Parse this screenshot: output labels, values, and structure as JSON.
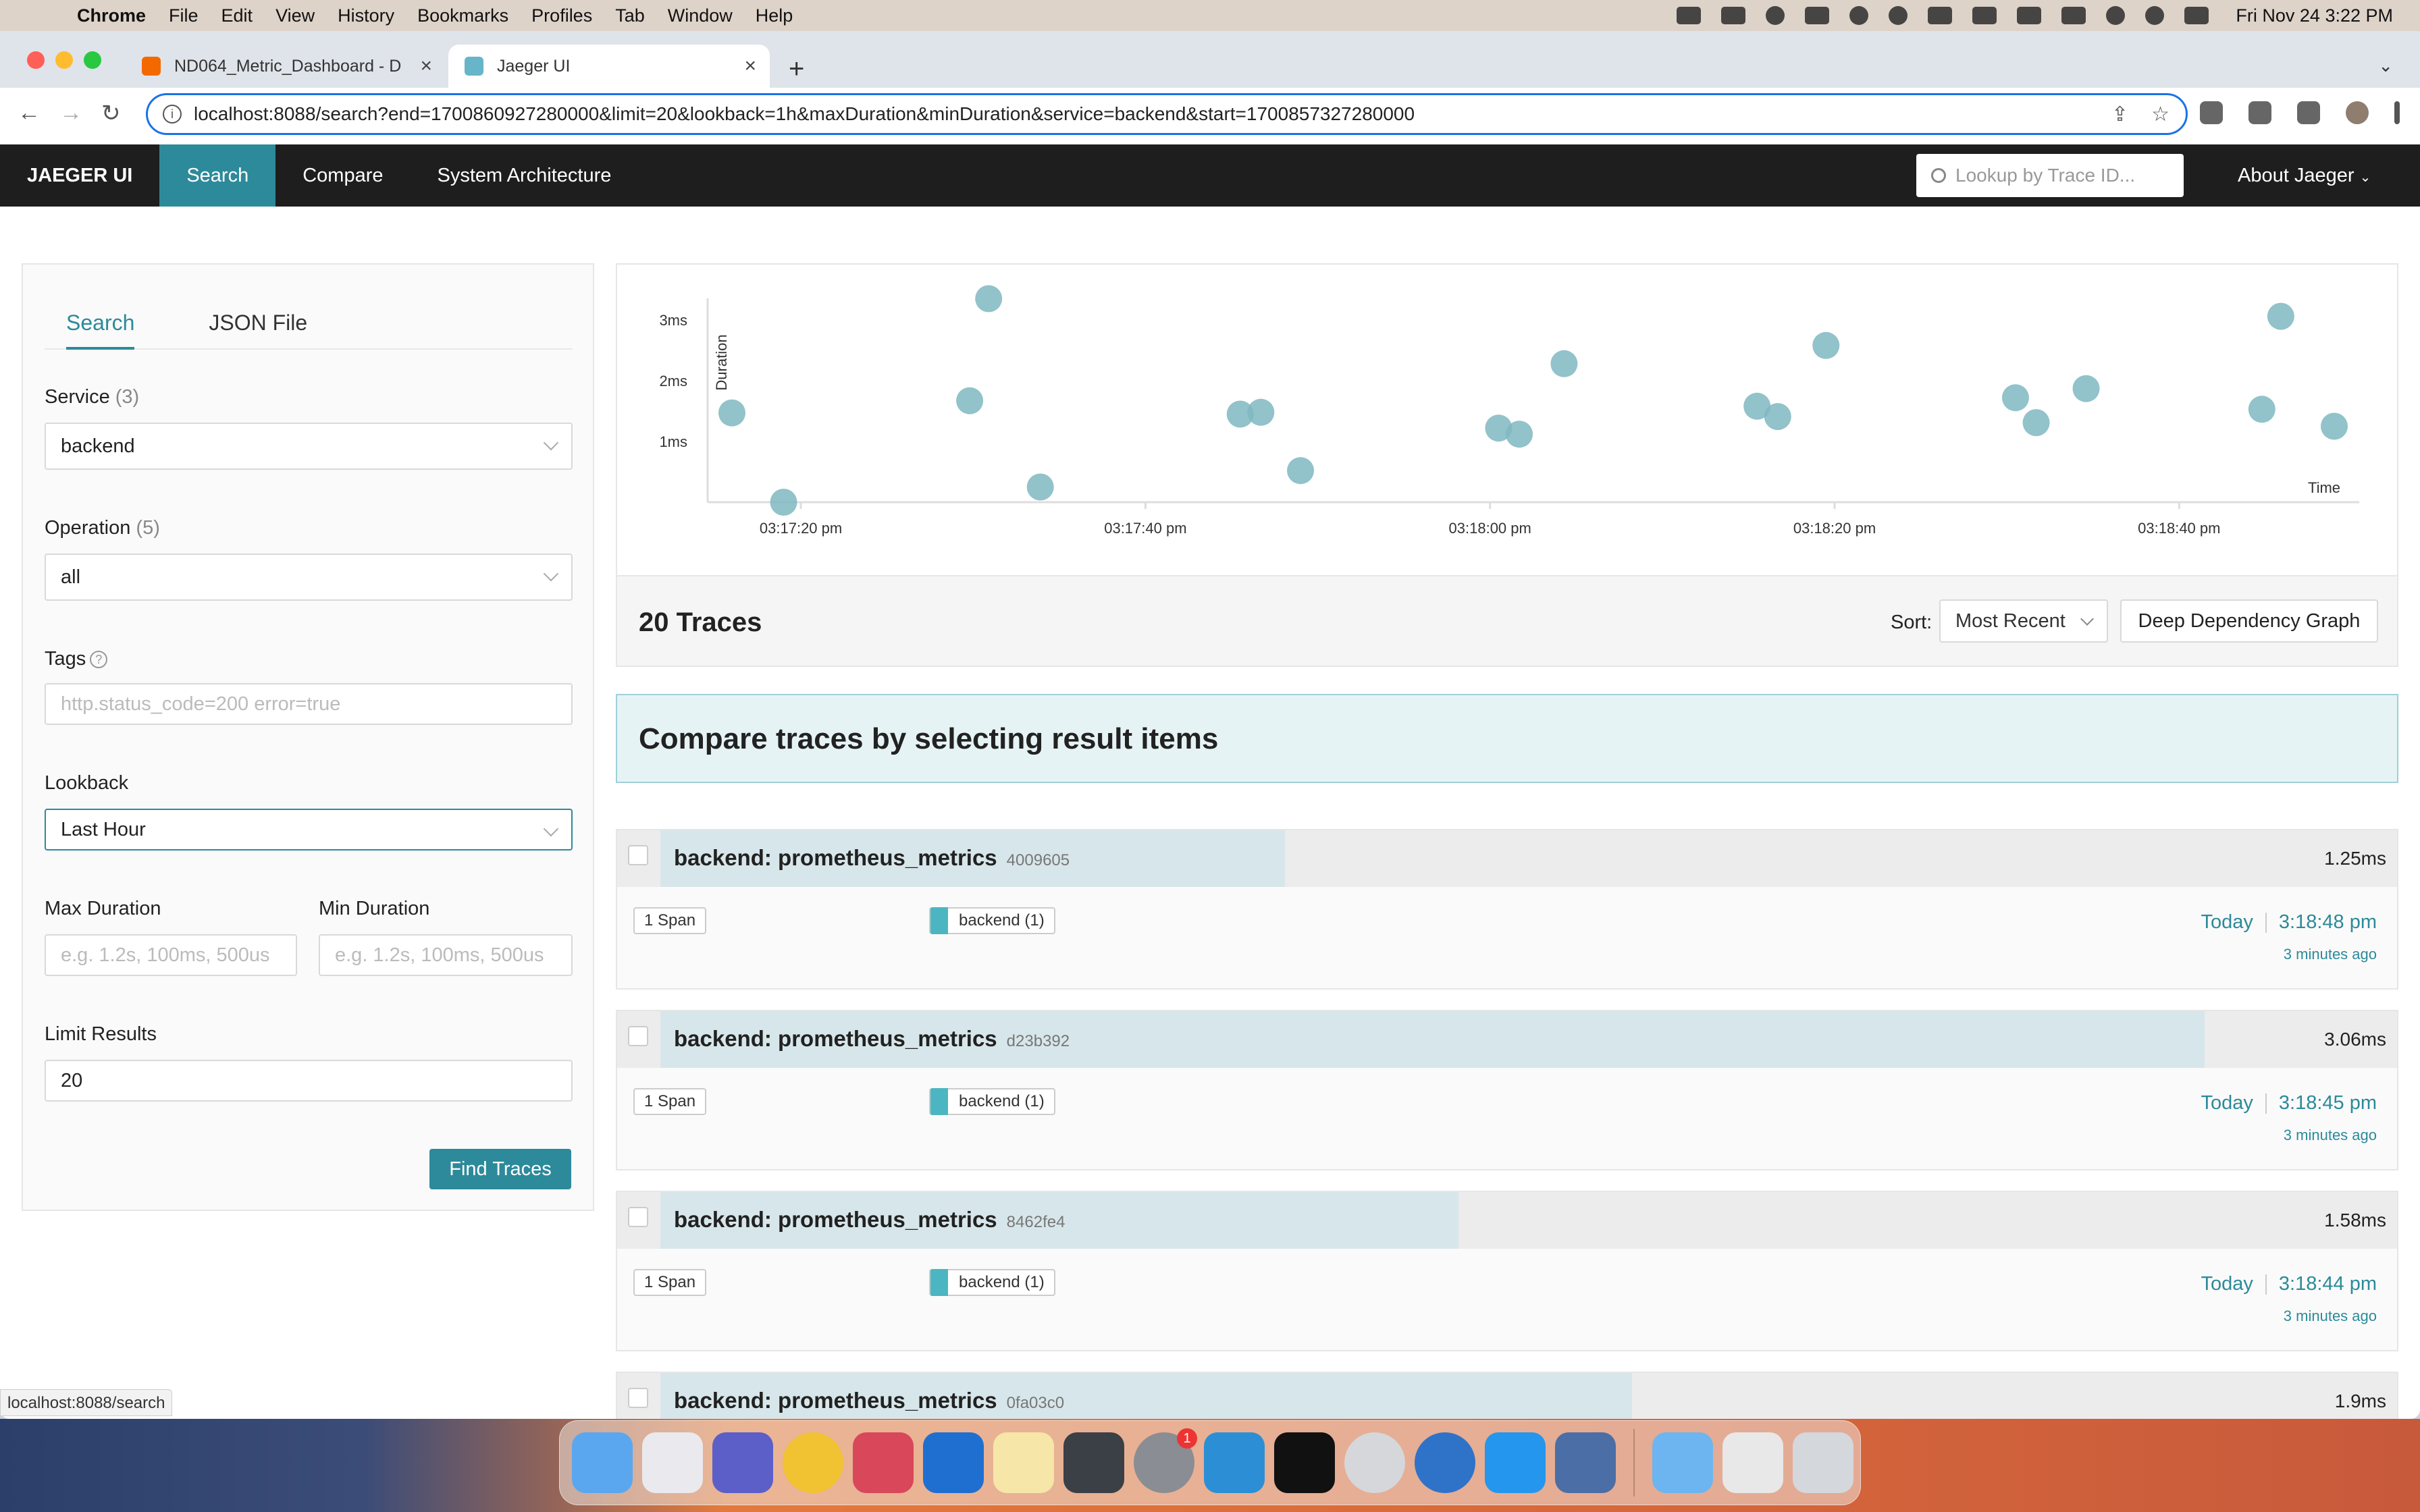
{
  "menubar": {
    "app": "Chrome",
    "items": [
      "File",
      "Edit",
      "View",
      "History",
      "Bookmarks",
      "Profiles",
      "Tab",
      "Window",
      "Help"
    ],
    "clock": "Fri Nov 24  3:22 PM"
  },
  "browser": {
    "tabs": [
      {
        "title": "ND064_Metric_Dashboard - D",
        "favicon_color": "#f46800"
      },
      {
        "title": "Jaeger UI",
        "favicon_color": "#66b5c9"
      }
    ],
    "url": "localhost:8088/search?end=1700860927280000&limit=20&lookback=1h&maxDuration&minDuration&service=backend&start=1700857327280000",
    "status_url": "localhost:8088/search"
  },
  "jaeger_nav": {
    "brand": "JAEGER UI",
    "items": [
      "Search",
      "Compare",
      "System Architecture"
    ],
    "lookup_placeholder": "Lookup by Trace ID...",
    "about": "About Jaeger"
  },
  "search_form": {
    "tabs": [
      "Search",
      "JSON File"
    ],
    "service_label": "Service",
    "service_count": "(3)",
    "service_value": "backend",
    "operation_label": "Operation",
    "operation_count": "(5)",
    "operation_value": "all",
    "tags_label": "Tags",
    "tags_placeholder": "http.status_code=200 error=true",
    "lookback_label": "Lookback",
    "lookback_value": "Last Hour",
    "max_duration_label": "Max Duration",
    "max_duration_placeholder": "e.g. 1.2s, 100ms, 500us",
    "min_duration_label": "Min Duration",
    "min_duration_placeholder": "e.g. 1.2s, 100ms, 500us",
    "limit_label": "Limit Results",
    "limit_value": "20",
    "find_button": "Find Traces"
  },
  "chart_data": {
    "type": "scatter",
    "title": "",
    "xlabel": "Time",
    "ylabel": "Duration",
    "x_ticks": [
      "03:17:20 pm",
      "03:17:40 pm",
      "03:18:00 pm",
      "03:18:20 pm",
      "03:18:40 pm"
    ],
    "y_ticks": [
      "1ms",
      "2ms",
      "3ms"
    ],
    "xlim": [
      -4.0,
      45.5
    ],
    "ylim": [
      0,
      3.7
    ],
    "x_units": "seconds after 03:17:16 pm",
    "y_units": "ms",
    "points": [
      {
        "x": 0.0,
        "y": 1.47
      },
      {
        "x": 3.0,
        "y": 0.0
      },
      {
        "x": 13.8,
        "y": 1.67
      },
      {
        "x": 14.9,
        "y": 3.35
      },
      {
        "x": 17.9,
        "y": 0.25
      },
      {
        "x": 29.5,
        "y": 1.45
      },
      {
        "x": 30.7,
        "y": 1.48
      },
      {
        "x": 33.0,
        "y": 0.52
      },
      {
        "x": 44.5,
        "y": 1.22
      },
      {
        "x": 45.7,
        "y": 1.12
      },
      {
        "x": 48.3,
        "y": 2.28
      },
      {
        "x": 59.5,
        "y": 1.58
      },
      {
        "x": 60.7,
        "y": 1.41
      },
      {
        "x": 63.5,
        "y": 2.58
      },
      {
        "x": 74.5,
        "y": 1.72
      },
      {
        "x": 75.7,
        "y": 1.31
      },
      {
        "x": 78.6,
        "y": 1.87
      },
      {
        "x": 88.8,
        "y": 1.53
      },
      {
        "x": 89.9,
        "y": 3.06
      },
      {
        "x": 93.0,
        "y": 1.25
      }
    ]
  },
  "results": {
    "count_label": "20 Traces",
    "sort_label": "Sort:",
    "sort_value": "Most Recent",
    "ddg_button": "Deep Dependency Graph",
    "compare_banner": "Compare traces by selecting result items"
  },
  "traces": [
    {
      "name": "backend: prometheus_metrics",
      "id": "4009605",
      "duration": "1.25ms",
      "duration_fraction": 0.36,
      "spans": "1 Span",
      "service_tag": "backend (1)",
      "day": "Today",
      "time": "3:18:48 pm",
      "ago": "3 minutes ago"
    },
    {
      "name": "backend: prometheus_metrics",
      "id": "d23b392",
      "duration": "3.06ms",
      "duration_fraction": 0.89,
      "spans": "1 Span",
      "service_tag": "backend (1)",
      "day": "Today",
      "time": "3:18:45 pm",
      "ago": "3 minutes ago"
    },
    {
      "name": "backend: prometheus_metrics",
      "id": "8462fe4",
      "duration": "1.58ms",
      "duration_fraction": 0.46,
      "spans": "1 Span",
      "service_tag": "backend (1)",
      "day": "Today",
      "time": "3:18:44 pm",
      "ago": "3 minutes ago"
    },
    {
      "name": "backend: prometheus_metrics",
      "id": "0fa03c0",
      "duration": "1.9ms",
      "duration_fraction": 0.56,
      "spans": "",
      "service_tag": "",
      "day": "",
      "time": "",
      "ago": ""
    }
  ]
}
